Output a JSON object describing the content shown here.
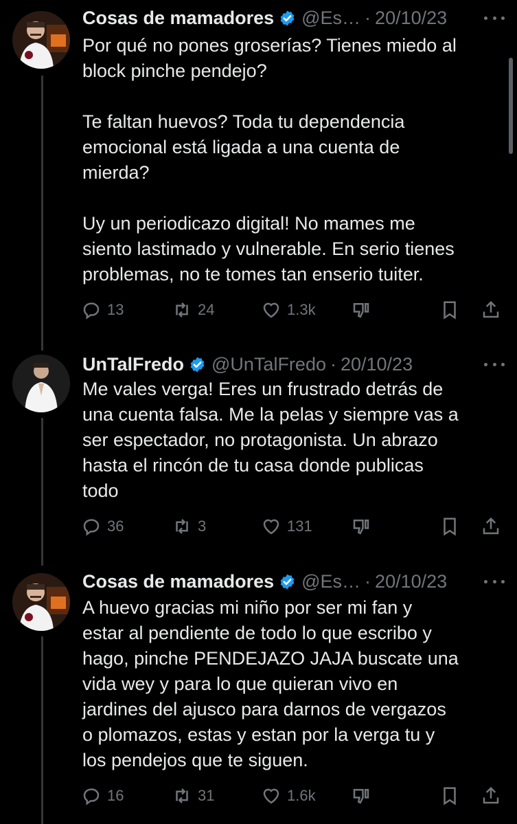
{
  "colors": {
    "background": "#000000",
    "text_primary": "#e7e9ea",
    "text_secondary": "#71767b",
    "verified_blue": "#1d9bf0",
    "thread_line": "#333639"
  },
  "tweets": [
    {
      "name": "Cosas de mamadores",
      "handle": "@Es…",
      "separator": "·",
      "date": "20/10/23",
      "verified": true,
      "text": "Por qué no pones groserías? Tienes miedo al\nblock pinche pendejo?\n\nTe faltan huevos? Toda tu dependencia\nemocional está ligada a una cuenta de\nmierda?\n\nUy un periodicazo digital! No mames me\nsiento lastimado y vulnerable. En serio tienes\nproblemas, no te tomes tan enserio tuiter.",
      "replies": "13",
      "retweets": "24",
      "likes": "1.3k"
    },
    {
      "name": "UnTalFredo",
      "handle": "@UnTalFredo",
      "separator": "·",
      "date": "20/10/23",
      "verified": true,
      "text": "Me vales verga! Eres un frustrado detrás de\nuna cuenta falsa. Me la pelas y siempre vas a\nser espectador, no protagonista. Un abrazo\nhasta el rincón de tu casa donde publicas\ntodo",
      "replies": "36",
      "retweets": "3",
      "likes": "131"
    },
    {
      "name": "Cosas de mamadores",
      "handle": "@Es…",
      "separator": "·",
      "date": "20/10/23",
      "verified": true,
      "text": "A huevo gracias mi niño por ser mi fan y\nestar al pendiente de todo lo que escribo y\nhago, pinche PENDEJAZO JAJA buscate una\nvida wey y para lo que quieran vivo en\njardines del ajusco para darnos de vergazos\no plomazos, estas y estan por la verga tu y\nlos pendejos que te siguen.",
      "replies": "16",
      "retweets": "31",
      "likes": "1.6k"
    }
  ]
}
